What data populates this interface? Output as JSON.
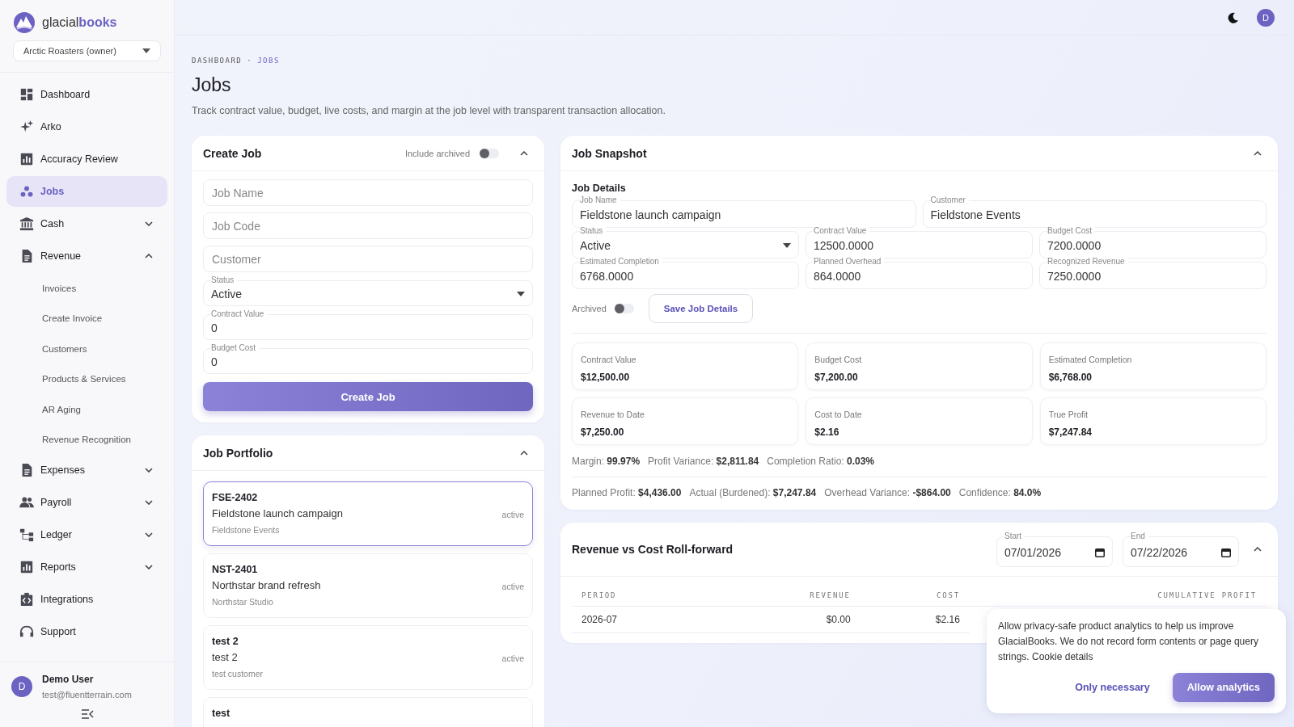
{
  "brand": {
    "name_light": "glacial",
    "name_bold": "books"
  },
  "company_select": {
    "value": "Arctic Roasters (owner)"
  },
  "sidebar": {
    "items": [
      {
        "label": "Dashboard",
        "selected": false
      },
      {
        "label": "Arko",
        "selected": false
      },
      {
        "label": "Accuracy Review",
        "selected": false
      },
      {
        "label": "Jobs",
        "selected": true
      },
      {
        "label": "Cash",
        "selected": false,
        "expanded": false
      },
      {
        "label": "Revenue",
        "selected": false,
        "expanded": true,
        "children": [
          {
            "label": "Invoices",
            "selected": false
          },
          {
            "label": "Create Invoice",
            "selected": false
          },
          {
            "label": "Customers",
            "selected": false
          },
          {
            "label": "Products & Services",
            "selected": false
          },
          {
            "label": "AR Aging",
            "selected": false
          },
          {
            "label": "Revenue Recognition",
            "selected": false
          }
        ]
      },
      {
        "label": "Expenses",
        "selected": false,
        "expanded": false
      },
      {
        "label": "Payroll",
        "selected": false,
        "expanded": false
      },
      {
        "label": "Ledger",
        "selected": false,
        "expanded": false
      },
      {
        "label": "Reports",
        "selected": false,
        "expanded": false
      },
      {
        "label": "Integrations",
        "selected": false
      },
      {
        "label": "Support",
        "selected": false
      }
    ]
  },
  "user": {
    "initial": "D",
    "name": "Demo User",
    "email": "test@fluentterrain.com"
  },
  "topbar": {
    "avatar_initial": "D"
  },
  "breadcrumb": {
    "items": [
      "DASHBOARD",
      "JOBS"
    ],
    "separator": "·"
  },
  "page": {
    "title": "Jobs",
    "subtitle": "Track contract value, budget, live costs, and margin at the job level with transparent transaction allocation."
  },
  "create_job": {
    "title": "Create Job",
    "expanded": true,
    "include_archived": {
      "label": "Include archived",
      "on": false
    },
    "fields": [
      {
        "kind": "placeholder",
        "placeholder": "Job Name"
      },
      {
        "kind": "placeholder",
        "placeholder": "Job Code"
      },
      {
        "kind": "placeholder",
        "placeholder": "Customer"
      },
      {
        "kind": "select",
        "label": "Status",
        "value": "Active"
      },
      {
        "kind": "text",
        "label": "Contract Value",
        "value": "0"
      },
      {
        "kind": "text",
        "label": "Budget Cost",
        "value": "0"
      }
    ],
    "submit": "Create Job"
  },
  "job_portfolio": {
    "title": "Job Portfolio",
    "expanded": true,
    "jobs": [
      {
        "code": "FSE-2402",
        "name": "Fieldstone launch campaign",
        "customer": "Fieldstone Events",
        "status": "active",
        "selected": true
      },
      {
        "code": "NST-2401",
        "name": "Northstar brand refresh",
        "customer": "Northstar Studio",
        "status": "active",
        "selected": false
      },
      {
        "code": "test 2",
        "name": "test 2",
        "customer": "test customer",
        "status": "active",
        "selected": false
      },
      {
        "code": "test",
        "selected": false
      }
    ]
  },
  "job_snapshot": {
    "title": "Job Snapshot",
    "expanded": true,
    "section": "Job Details",
    "fields": [
      {
        "kind": "text",
        "label": "Job Name",
        "value": "Fieldstone launch campaign"
      },
      {
        "kind": "text",
        "label": "Customer",
        "value": "Fieldstone Events"
      },
      {
        "kind": "select",
        "label": "Status",
        "value": "Active"
      },
      {
        "kind": "text",
        "label": "Contract Value",
        "value": "12500.0000"
      },
      {
        "kind": "text",
        "label": "Budget Cost",
        "value": "7200.0000"
      },
      {
        "kind": "text",
        "label": "Estimated Completion",
        "value": "6768.0000"
      },
      {
        "kind": "text",
        "label": "Planned Overhead",
        "value": "864.0000"
      },
      {
        "kind": "text",
        "label": "Recognized Revenue",
        "value": "7250.0000"
      }
    ],
    "archived": {
      "label": "Archived",
      "on": false
    },
    "save_button": "Save Job Details",
    "metrics": [
      {
        "label": "Contract Value",
        "value": "$12,500.00"
      },
      {
        "label": "Budget Cost",
        "value": "$7,200.00"
      },
      {
        "label": "Estimated Completion",
        "value": "$6,768.00"
      },
      {
        "label": "Revenue to Date",
        "value": "$7,250.00"
      },
      {
        "label": "Cost to Date",
        "value": "$2.16"
      },
      {
        "label": "True Profit",
        "value": "$7,247.84"
      }
    ],
    "summary_lines": [
      [
        {
          "label": "Margin:",
          "value": "99.97%"
        },
        {
          "label": "Profit Variance:",
          "value": "$2,811.84"
        },
        {
          "label": "Completion Ratio:",
          "value": "0.03%"
        }
      ],
      [
        {
          "label": "Planned Profit:",
          "value": "$4,436.00"
        },
        {
          "label": "Actual (Burdened):",
          "value": "$7,247.84"
        },
        {
          "label": "Overhead Variance:",
          "value": "-$864.00"
        },
        {
          "label": "Confidence:",
          "value": "84.0%"
        }
      ]
    ]
  },
  "roll_forward": {
    "title": "Revenue vs Cost Roll-forward",
    "expanded": true,
    "start": {
      "label": "Start",
      "value": "07/01/2026"
    },
    "end": {
      "label": "End",
      "value": "07/22/2026"
    },
    "table": {
      "columns": [
        "PERIOD",
        "REVENUE",
        "COST",
        "CUMULATIVE PROFIT"
      ],
      "rows": [
        [
          "2026-07",
          "$0.00",
          "$2.16"
        ]
      ]
    }
  },
  "cookie_banner": {
    "text": "Allow privacy-safe product analytics to help us improve GlacialBooks. We do not record form contents or page query strings.",
    "link": "Cookie details",
    "buttons": [
      {
        "kind": "text",
        "label": "Only necessary"
      },
      {
        "kind": "primary",
        "label": "Allow analytics"
      }
    ]
  }
}
